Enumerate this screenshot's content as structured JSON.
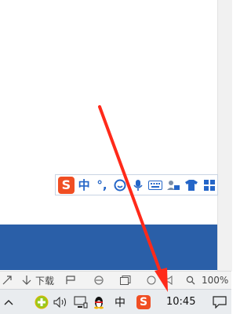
{
  "ime_toolbar": {
    "logo": "S",
    "mode": "中",
    "punct": "°,",
    "icons": [
      "face-icon",
      "microphone-icon",
      "keyboard-icon",
      "user-card-icon",
      "shirt-icon",
      "grid-icon"
    ]
  },
  "status_bar": {
    "download_label": "下载",
    "zoom": "100%"
  },
  "taskbar": {
    "ime_indicator": "中",
    "sogou_logo": "S",
    "clock": "10:45"
  },
  "colors": {
    "accent_blue": "#2a5fa8",
    "sogou_orange": "#f04e23",
    "arrow_red": "#ff2a1a"
  }
}
